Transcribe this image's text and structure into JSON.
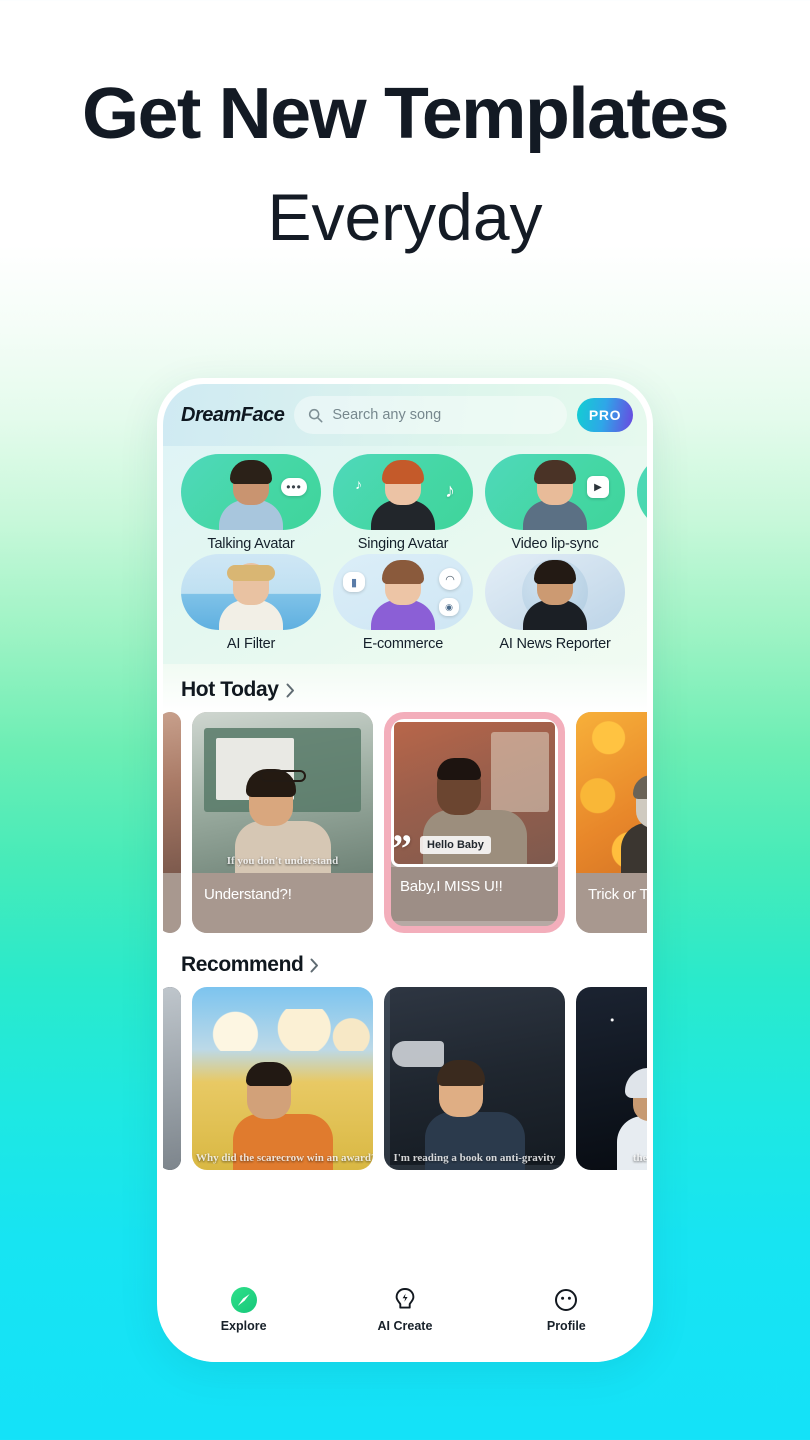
{
  "headline": {
    "line1": "Get New Templates",
    "line2": "Everyday"
  },
  "app": {
    "logo": "DreamFace",
    "search": {
      "placeholder": "Search any song",
      "icon": "search-icon"
    },
    "pro_badge": "PRO"
  },
  "categories": {
    "row1": [
      {
        "label": "Talking Avatar",
        "icon": "speech-bubble-icon"
      },
      {
        "label": "Singing Avatar",
        "icon": "music-note-icon"
      },
      {
        "label": "Video lip-sync",
        "icon": "play-button-icon"
      }
    ],
    "row2": [
      {
        "label": "AI Filter",
        "icon": "beach-icon"
      },
      {
        "label": "E-commerce",
        "icon": "shopping-bag-icon"
      },
      {
        "label": "AI News Reporter",
        "icon": "globe-icon"
      }
    ]
  },
  "sections": {
    "hot_today": {
      "title": "Hot Today",
      "chevron": "chevron-right-icon",
      "cards": [
        {
          "caption": "Understand?!",
          "burn_in": "If you don't understand",
          "scene": "classroom"
        },
        {
          "caption": "Baby,I MISS U!!",
          "burn_in": "Hello Baby",
          "scene": "city-street",
          "highlighted": true
        },
        {
          "caption": "Trick or T",
          "burn_in": "",
          "scene": "pumpkins"
        }
      ]
    },
    "recommend": {
      "title": "Recommend",
      "chevron": "chevron-right-icon",
      "cards": [
        {
          "burn_in": "Why did the scarecrow win an award?",
          "scene": "wheat-field"
        },
        {
          "burn_in": "I'm reading a book on anti-gravity",
          "scene": "cyber-city"
        },
        {
          "burn_in": "the catastroph",
          "scene": "space-suit"
        }
      ]
    }
  },
  "bottom_nav": [
    {
      "label": "Explore",
      "icon": "compass-icon",
      "active": true
    },
    {
      "label": "AI Create",
      "icon": "lightbulb-bolt-icon",
      "active": false
    },
    {
      "label": "Profile",
      "icon": "face-icon",
      "active": false
    }
  ],
  "colors": {
    "accent_green": "#2ee08a",
    "bg_cyan": "#14e2f8",
    "pro_gradient_start": "#12cfd2",
    "pro_gradient_end": "#6b46e0",
    "highlight_pink": "#f3aebb",
    "headline_text": "#131a24"
  }
}
